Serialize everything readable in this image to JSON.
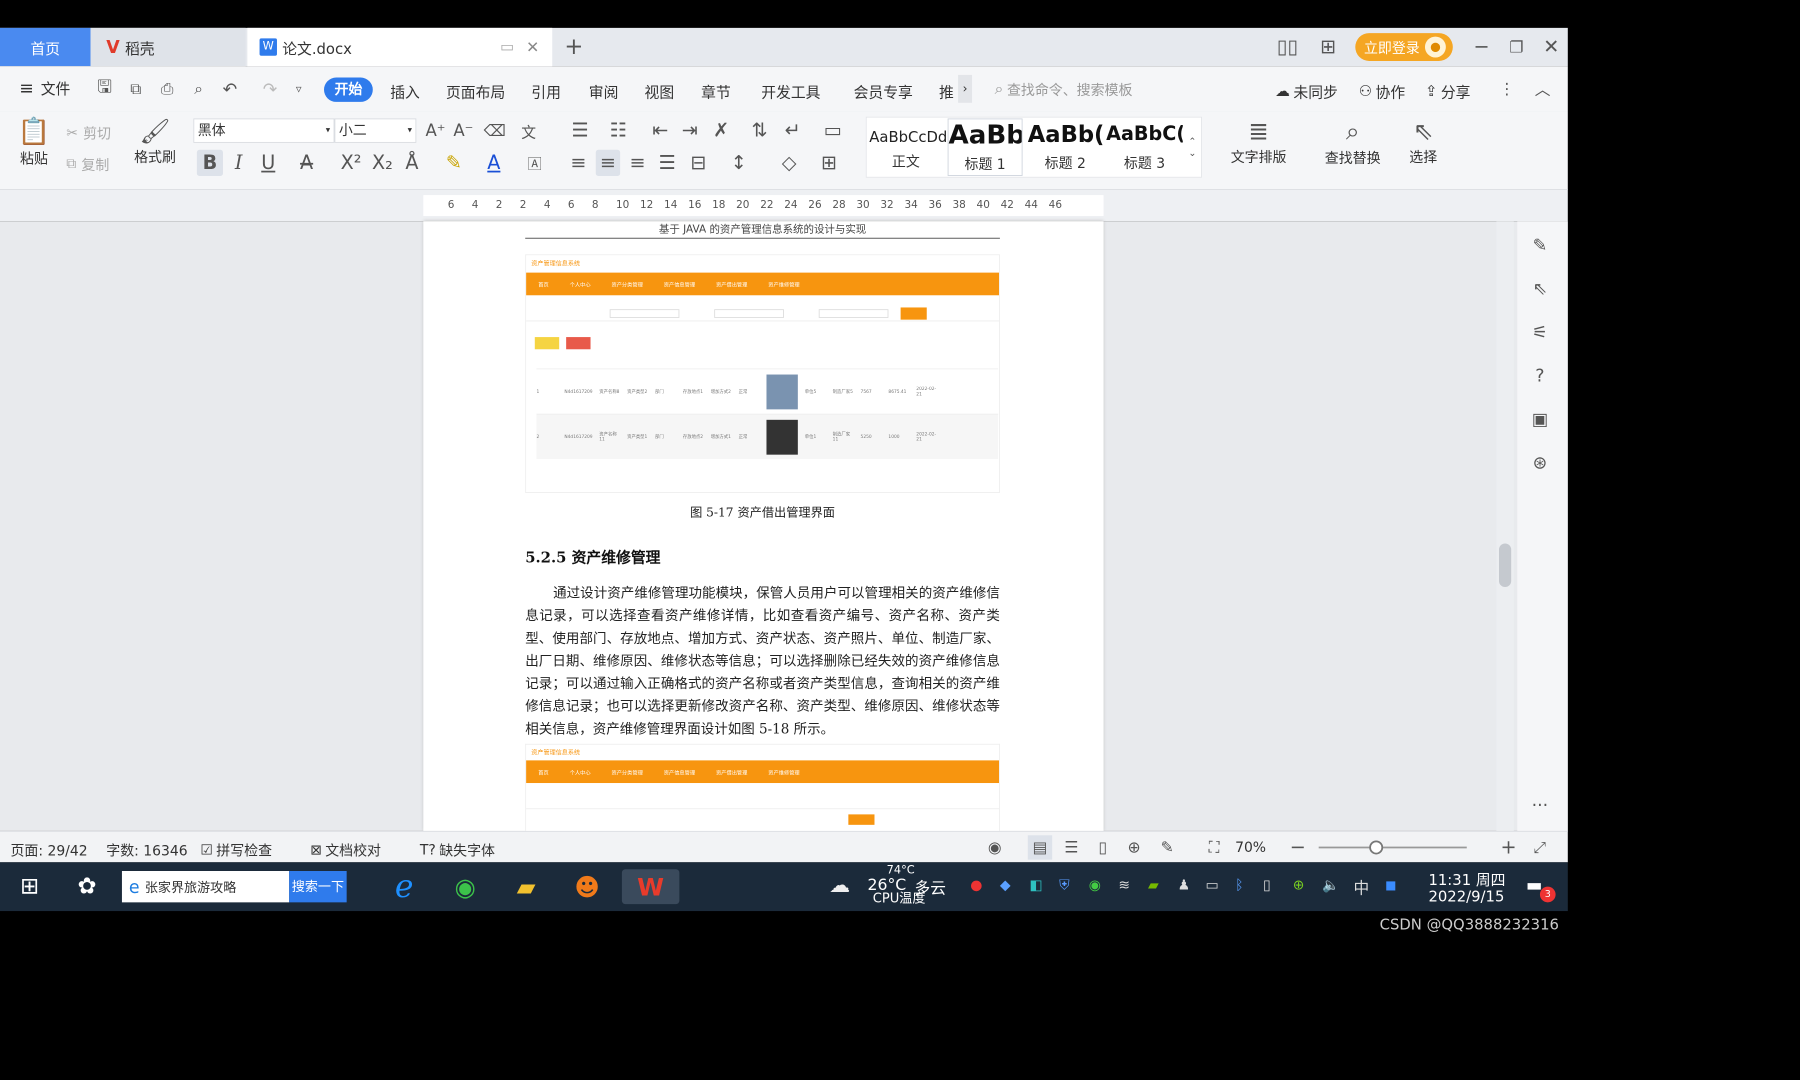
{
  "tabs": {
    "home": "首页",
    "docer": "稻壳",
    "doc": "论文.docx",
    "plus": "+",
    "login": "立即登录"
  },
  "menu": {
    "hamburger": "≡",
    "file": "文件",
    "items": [
      "开始",
      "插入",
      "页面布局",
      "引用",
      "审阅",
      "视图",
      "章节",
      "开发工具",
      "会员专享",
      "推"
    ],
    "search_placeholder": "查找命令、搜索模板",
    "sync": "未同步",
    "collab": "协作",
    "share": "分享"
  },
  "ribbon": {
    "paste": "粘贴",
    "cut": "剪切",
    "copy": "复制",
    "format_painter": "格式刷",
    "font": "黑体",
    "size": "小二",
    "styles": [
      {
        "sample": "AaBbCcDd",
        "name": "正文"
      },
      {
        "sample": "AaBb",
        "name": "标题 1"
      },
      {
        "sample": "AaBb(",
        "name": "标题 2"
      },
      {
        "sample": "AaBbC(",
        "name": "标题 3"
      }
    ],
    "text_layout": "文字排版",
    "find_replace": "查找替换",
    "select": "选择"
  },
  "ruler": {
    "ticks": [
      "6",
      "4",
      "2",
      "2",
      "4",
      "6",
      "8",
      "10",
      "12",
      "14",
      "16",
      "18",
      "20",
      "22",
      "24",
      "26",
      "28",
      "30",
      "32",
      "34",
      "36",
      "38",
      "40",
      "42",
      "44",
      "46"
    ]
  },
  "document": {
    "header": "基于 JAVA 的资产管理信息系统的设计与实现",
    "caption": "图 5-17 资产借出管理界面",
    "heading": "5.2.5  资产维修管理",
    "paragraph": "通过设计资产维修管理功能模块，保管人员用户可以管理相关的资产维修信息记录，可以选择查看资产维修详情，比如查看资产编号、资产名称、资产类型、使用部门、存放地点、增加方式、资产状态、资产照片、单位、制造厂家、出厂日期、维修原因、维修状态等信息；可以选择删除已经失效的资产维修信息记录；可以通过输入正确格式的资产名称或者资产类型信息，查询相关的资产维修信息记录；也可以选择更新修改资产名称、资产类型、维修原因、维修状态等相关信息，资产维修管理界面设计如图 5-18 所示。",
    "mock_title": "资产管理信息系统",
    "mock_nav": [
      "首页",
      "个人中心",
      "资产分类管理",
      "资产信息管理",
      "资产借出管理",
      "资产维修管理"
    ],
    "mock_rows": [
      [
        "1",
        "N4d161720927",
        "资产名称8",
        "资产类型2",
        "部门",
        "存放地点1",
        "增加方式2",
        "正常",
        "单位5",
        "制造厂家5",
        "7567",
        "8675.41",
        "2022-02-21"
      ],
      [
        "2",
        "N4d161720927",
        "资产名称11",
        "资产类型1",
        "部门",
        "存放地点2",
        "增加方式1",
        "正常",
        "单位1",
        "制造厂家11",
        "5250",
        "1000",
        "2022-02-21"
      ]
    ]
  },
  "status": {
    "page": "页面: 29/42",
    "words": "字数: 16346",
    "spell": "拼写检查",
    "proof": "文档校对",
    "missing_font": "缺失字体",
    "zoom": "70%"
  },
  "taskbar": {
    "search_text": "张家界旅游攻略",
    "search_btn": "搜索一下",
    "weather_temp": "26°C",
    "weather": "多云",
    "cpu_temp": "74°C",
    "cpu_label": "CPU温度",
    "ime": "中",
    "time": "11:31 周四",
    "date": "2022/9/15",
    "badge": "3"
  },
  "watermark": "CSDN @QQ3888232316",
  "colors": {
    "accent": "#2f7bec",
    "orange": "#f7950f",
    "login": "#f5a623"
  }
}
